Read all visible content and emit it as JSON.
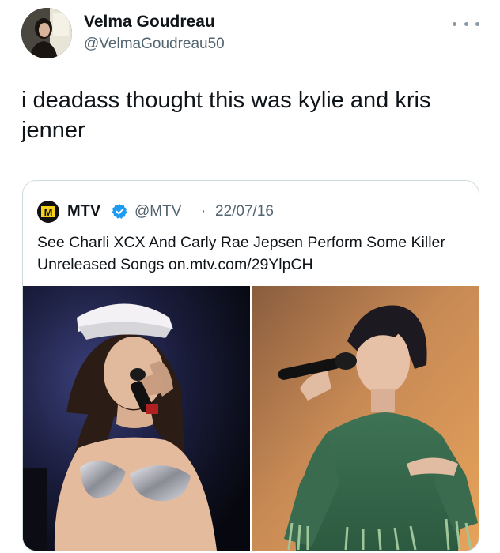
{
  "tweet": {
    "author_name": "Velma Goudreau",
    "author_handle": "@VelmaGoudreau50",
    "avatar_icon": "user-avatar",
    "more_icon": "more-dots-icon",
    "text": "i deadass thought this was kylie and kris jenner"
  },
  "quoted_tweet": {
    "logo_text": "M",
    "author_name": "MTV",
    "verified_icon": "verified-badge-icon",
    "author_handle": "@MTV",
    "separator": "·",
    "date": "22/07/16",
    "text": "See Charli XCX And Carly Rae Jepsen Perform Some Killer Unreleased Songs on.mtv.com/29YlpCH",
    "photos": [
      {
        "name": "performer-left-photo"
      },
      {
        "name": "performer-right-photo"
      }
    ]
  },
  "colors": {
    "text_primary": "#0f1419",
    "text_secondary": "#536471",
    "border": "#cfd9de",
    "verified_blue": "#1d9bf0"
  }
}
